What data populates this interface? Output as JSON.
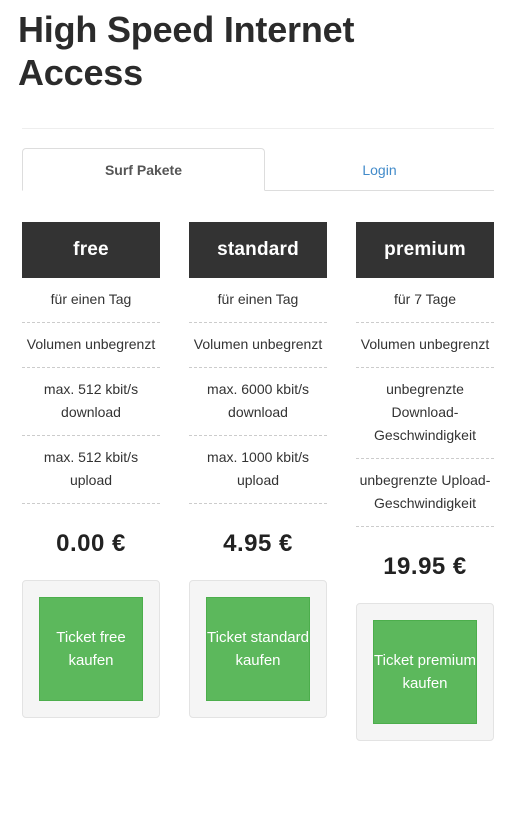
{
  "page": {
    "title": "High Speed Internet Access"
  },
  "tabs": [
    {
      "label": "Surf Pakete",
      "active": true
    },
    {
      "label": "Login",
      "active": false
    }
  ],
  "colors": {
    "header_bg": "#333333",
    "buy_green": "#5cb85c",
    "panel_gray": "#f5f5f5",
    "link_blue": "#428bca"
  },
  "plans": [
    {
      "name": "free",
      "features": [
        "für einen Tag",
        "Volumen unbegrenzt",
        "max. 512 kbit/s download",
        "max. 512 kbit/s upload"
      ],
      "price": "0.00 €",
      "buy_label": "Ticket free kaufen"
    },
    {
      "name": "standard",
      "features": [
        "für einen Tag",
        "Volumen unbegrenzt",
        "max. 6000 kbit/s download",
        "max. 1000 kbit/s upload"
      ],
      "price": "4.95 €",
      "buy_label": "Ticket standard kaufen"
    },
    {
      "name": "premium",
      "features": [
        "für 7 Tage",
        "Volumen unbegrenzt",
        "unbegrenzte Download-Geschwindigkeit",
        "unbegrenzte Upload-Geschwindigkeit"
      ],
      "price": "19.95 €",
      "buy_label": "Ticket premium kaufen"
    }
  ]
}
